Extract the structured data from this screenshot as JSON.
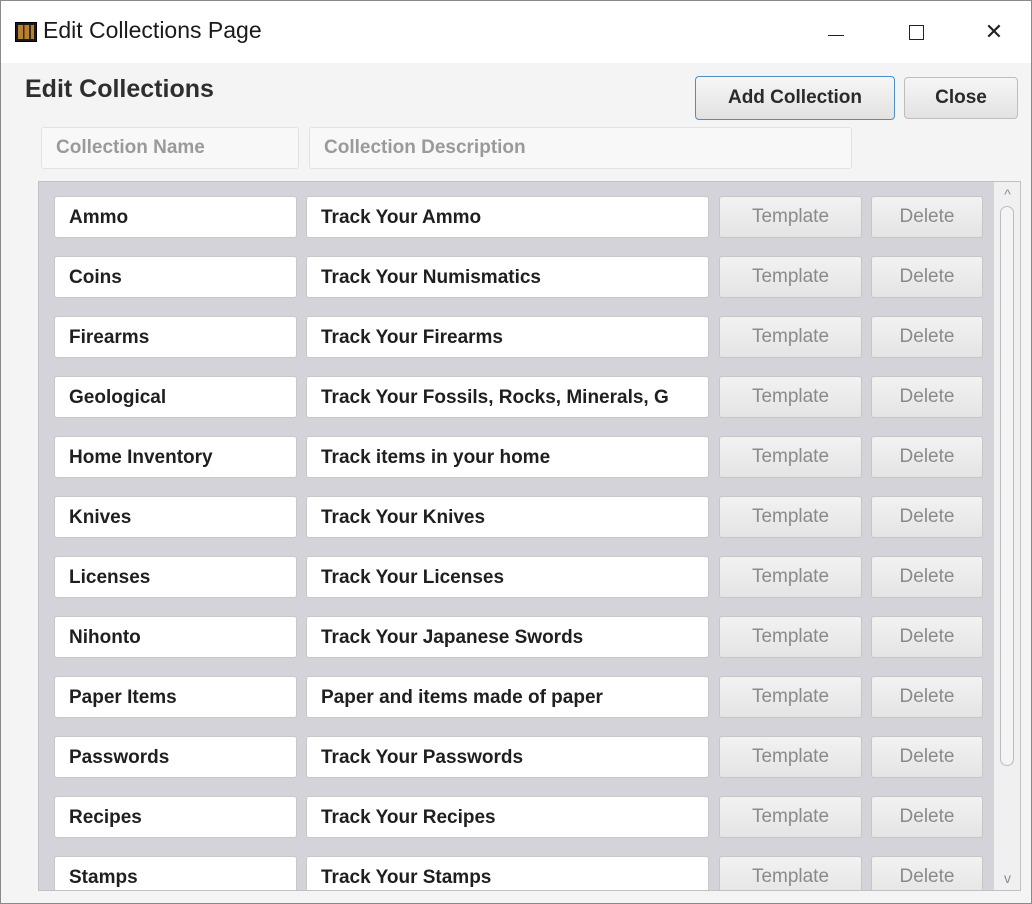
{
  "window": {
    "title": "Edit Collections Page",
    "minimize_label": "—",
    "maximize_label": "□",
    "close_label": "✕"
  },
  "header": {
    "title": "Edit Collections",
    "add_label": "Add Collection",
    "close_label": "Close",
    "name_placeholder": "Collection Name",
    "desc_placeholder": "Collection Description"
  },
  "row_buttons": {
    "template_label": "Template",
    "delete_label": "Delete"
  },
  "collections": [
    {
      "name": "Ammo",
      "description": "Track Your Ammo"
    },
    {
      "name": "Coins",
      "description": "Track Your Numismatics"
    },
    {
      "name": "Firearms",
      "description": "Track Your Firearms"
    },
    {
      "name": "Geological",
      "description": "Track Your Fossils, Rocks, Minerals, G"
    },
    {
      "name": "Home Inventory",
      "description": "Track items in your home"
    },
    {
      "name": "Knives",
      "description": "Track Your Knives"
    },
    {
      "name": "Licenses",
      "description": "Track Your Licenses"
    },
    {
      "name": "Nihonto",
      "description": "Track Your Japanese Swords"
    },
    {
      "name": "Paper Items",
      "description": "Paper and items made of paper"
    },
    {
      "name": "Passwords",
      "description": "Track Your Passwords"
    },
    {
      "name": "Recipes",
      "description": "Track Your Recipes"
    },
    {
      "name": "Stamps",
      "description": "Track Your Stamps"
    }
  ],
  "scrollbar": {
    "up_icon": "^",
    "down_icon": "v"
  }
}
